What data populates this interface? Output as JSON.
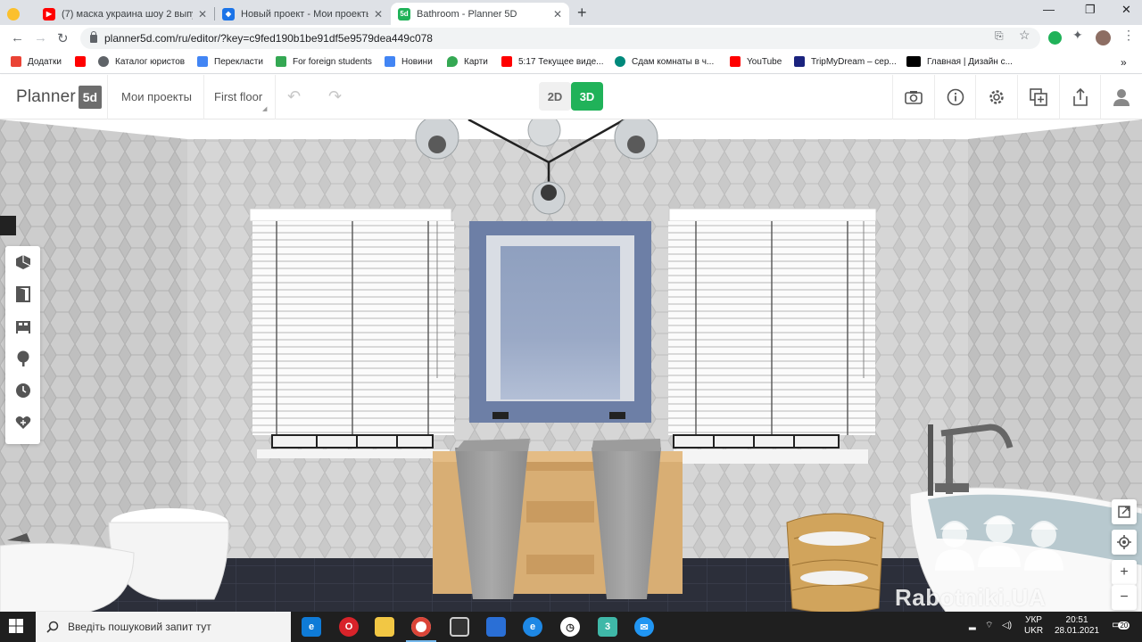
{
  "browser": {
    "tabs": [
      {
        "title": "(7) маска украина шоу 2 выпус",
        "icon": "youtube-icon",
        "color": "#ff0000"
      },
      {
        "title": "Новый проект - Мои проекты -",
        "icon": "planner-icon",
        "color": "#1a73e8"
      },
      {
        "title": "Bathroom - Planner 5D",
        "icon": "planner5d-icon",
        "color": "#20b259",
        "active": true
      }
    ],
    "url": "planner5d.com/ru/editor/?key=c9fed190b1be91df5e9579dea449c078",
    "bookmarks": [
      {
        "label": "Додатки",
        "color": "#ea4335"
      },
      {
        "label": "",
        "color": "#ff0000"
      },
      {
        "label": "Каталог юристов",
        "color": "#5f6368"
      },
      {
        "label": "Перекласти",
        "color": "#4285f4"
      },
      {
        "label": "For foreign students",
        "color": "#34a853"
      },
      {
        "label": "Новини",
        "color": "#4285f4"
      },
      {
        "label": "Карти",
        "color": "#34a853"
      },
      {
        "label": "5:17 Текущее виде...",
        "color": "#ff0000"
      },
      {
        "label": "Сдам комнаты в ч...",
        "color": "#00897b"
      },
      {
        "label": "YouTube",
        "color": "#ff0000"
      },
      {
        "label": "TripMyDream – сер...",
        "color": "#1a237e"
      },
      {
        "label": "Главная | Дизайн с...",
        "color": "#000000"
      }
    ]
  },
  "app": {
    "logo_text": "Planner",
    "logo_badge": "5d",
    "my_projects": "Мои проекты",
    "floor": "First floor",
    "view_2d": "2D",
    "view_3d": "3D",
    "accent": "#20b259"
  },
  "watermark": "Rabotniki.UA",
  "taskbar": {
    "search_placeholder": "Введіть пошуковий запит тут",
    "lang_top": "УКР",
    "lang_bottom": "UKR",
    "time": "20:51",
    "date": "28.01.2021",
    "notifications": "20"
  }
}
